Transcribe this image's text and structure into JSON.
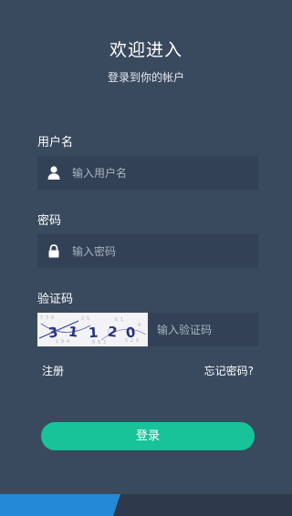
{
  "header": {
    "title": "欢迎进入",
    "subtitle": "登录到你的帐户"
  },
  "form": {
    "username": {
      "label": "用户名",
      "placeholder": "输入用户名",
      "icon": "user-icon"
    },
    "password": {
      "label": "密码",
      "placeholder": "输入密码",
      "icon": "lock-icon"
    },
    "captcha": {
      "label": "验证码",
      "image_text": "3 1 1 2 0",
      "placeholder": "输入验证码"
    }
  },
  "links": {
    "register": "注册",
    "forgot_password": "忘记密码?"
  },
  "login_button": "登录",
  "colors": {
    "background": "#3a4a5e",
    "field_background": "#324155",
    "button": "#18c39a",
    "accent": "#2489d6"
  }
}
